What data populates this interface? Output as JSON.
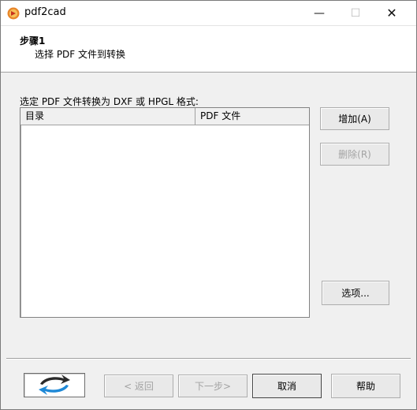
{
  "window": {
    "title": "pdf2cad",
    "minimize_glyph": "—",
    "maximize_glyph": "☐",
    "close_glyph": "✕"
  },
  "header": {
    "step_title": "步骤1",
    "step_subtitle": "选择 PDF 文件到转换"
  },
  "file_list": {
    "label": "选定 PDF 文件转换为 DXF 或 HPGL 格式:",
    "columns": [
      "目录",
      "PDF 文件"
    ],
    "rows": []
  },
  "side_buttons": {
    "add": "增加(A)",
    "remove": "删除(R)",
    "options": "选项..."
  },
  "footer": {
    "back": "< 返回",
    "next": "下一步>",
    "cancel": "取消",
    "help": "帮助"
  },
  "icons": {
    "app": "pdf2cad-app-icon",
    "logo": "pdf2cad-arrows-logo"
  },
  "colors": {
    "logo_blue": "#1e88d6",
    "logo_dark": "#2b2b2b",
    "disabled_text": "#a3a3a3"
  }
}
